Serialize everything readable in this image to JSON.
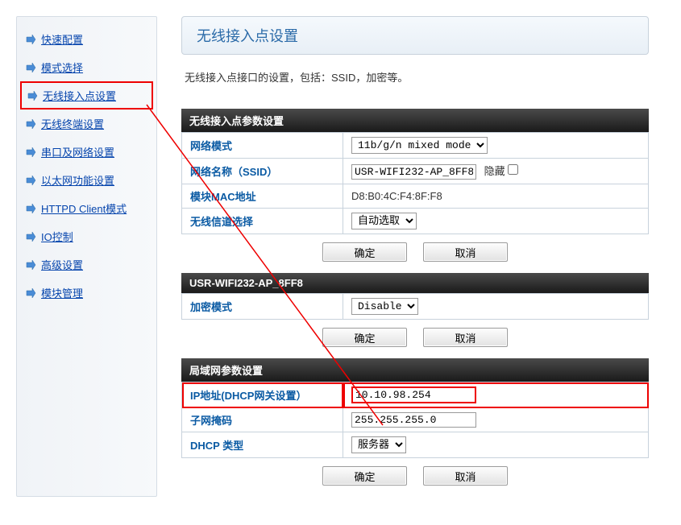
{
  "sidebar": {
    "items": [
      {
        "label": "快速配置"
      },
      {
        "label": "模式选择"
      },
      {
        "label": "无线接入点设置"
      },
      {
        "label": "无线终端设置"
      },
      {
        "label": "串口及网络设置"
      },
      {
        "label": "以太网功能设置"
      },
      {
        "label": "HTTPD Client模式"
      },
      {
        "label": "IO控制"
      },
      {
        "label": "高级设置"
      },
      {
        "label": "模块管理"
      }
    ]
  },
  "page": {
    "title": "无线接入点设置",
    "desc": "无线接入点接口的设置，包括：SSID，加密等。"
  },
  "panel1": {
    "header": "无线接入点参数设置",
    "network_mode_label": "网络模式",
    "network_mode_value": "11b/g/n mixed mode",
    "ssid_label": "网络名称（SSID）",
    "ssid_value": "USR-WIFI232-AP_8FF8",
    "hide_label": "隐藏",
    "mac_label": "模块MAC地址",
    "mac_value": "D8:B0:4C:F4:8F:F8",
    "channel_label": "无线信道选择",
    "channel_value": "自动选取",
    "ok": "确定",
    "cancel": "取消"
  },
  "panel2": {
    "header": "USR-WIFI232-AP_8FF8",
    "enc_label": "加密模式",
    "enc_value": "Disable",
    "ok": "确定",
    "cancel": "取消"
  },
  "panel3": {
    "header": "局域网参数设置",
    "ip_label": "IP地址(DHCP网关设置）",
    "ip_value": "10.10.98.254",
    "netmask_label": "子网掩码",
    "netmask_value": "255.255.255.0",
    "dhcp_label": "DHCP 类型",
    "dhcp_value": "服务器",
    "ok": "确定",
    "cancel": "取消"
  }
}
